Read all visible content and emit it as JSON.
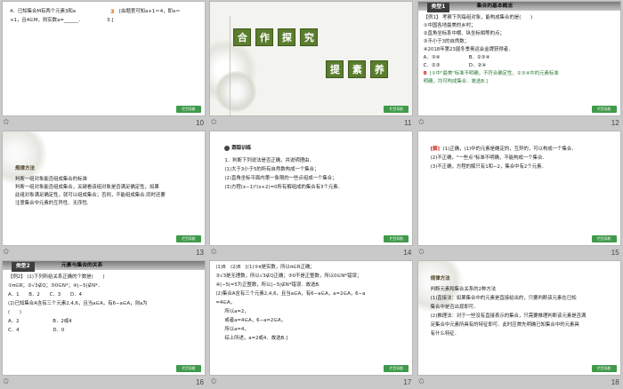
{
  "colors": {
    "accent_green": "#3f9a4a",
    "red": "#c8281e",
    "orange": "#e06a10",
    "dark_bar": "#3d3d3d"
  },
  "common": {
    "button_label": "栏目导航",
    "star_glyph": "✩"
  },
  "slides": [
    {
      "number": "10",
      "lines": [
        "4．已知集合M有两个元素3和a",
        "+1，且4∈M，则实数a=______．"
      ],
      "answer_num": "3",
      "answer_text": "[由题意可知a+1＝4，即a＝",
      "answer_text2": "3.]"
    },
    {
      "number": "11",
      "row1": [
        "合",
        "作",
        "探",
        "究"
      ],
      "row2": [
        "提",
        "素",
        "养"
      ]
    },
    {
      "number": "12",
      "category": "类型1",
      "category_title": "集合的基本概念",
      "lines": [
        "【例1】 考察下列每组对象，能构成集合的是(　　)",
        "①中国各地最美的乡村；",
        "②直角坐标系中横、纵坐标相等的点；",
        "③不小于3的自然数；",
        "④2018年第23届冬季奥运会金牌获得者．",
        "A．③④　　　　　　B．②③④",
        "C．②③　　　　　　D．②④"
      ],
      "sol_label": "B",
      "sol1": "[①中\"最美\"标准不明确，不符合确定性，②③④中的元素标准",
      "sol2": "明确，均可构成集合．故选B.]"
    },
    {
      "number": "13",
      "label": "规律方法",
      "lines": [
        "判断一组对象能否组成集合的标准",
        "判断一组对象能否组成集合，关键看该组对象是否满足确定性，如果",
        "此组对象满足确定性，就可以组成集合；否则，不能组成集合.同时还要",
        "注意集合中元素的互异性、无序性."
      ]
    },
    {
      "number": "14",
      "label": "跟踪训练",
      "lines": [
        "1．判断下列说法是否正确，并说明理由．",
        "(1)大于3小于5的所有自然数构成一个集合；",
        "(2)直角坐标平面内第一象限的一些点组成一个集合；",
        "(3)方程(x−1)²(x+2)=0所有解组成的集合有3个元素．"
      ]
    },
    {
      "number": "15",
      "jie": "[解]",
      "lines": [
        "(1)正确，(1)中的元素是确定的，互异的，可以构成一个集合．",
        "(2)不正确，\"一些点\"标准不明确，不能构成一个集合．",
        "(3)不正确，方程的解只有1和−2，集合中有2个元素．"
      ]
    },
    {
      "number": "16",
      "category": "类型2",
      "category_title": "元素与集合的关系",
      "lines": [
        "【例2】 (1)下列所给关系正确的个数是(　　)",
        "①π∈R；②√3∉Q；③0∈N*；④|−5|∉N*．",
        "A．1　　B．2　　C．3　　D．4",
        "(2)已知集合A含有三个元素2,4,6，且当a∈A，有6−a∈A，则a为",
        "(　　)",
        "A．2　　　　　　　B．2或4",
        "C．4　　　　　　　D．0"
      ]
    },
    {
      "number": "17",
      "lines": [
        "(1)B　(2)B　[(1)①π是实数，所以π∈R正确；",
        "②√3是无理数，所以√3∉Q正确；③0不是正整数，所以0∈N*错误；",
        "④|−5|=5为正整数，所以|−5|∉N*错误．故选B.",
        "(2)集合A含有三个元素2,4,6，且当a∈A，有6−a∈A，a=2∈A，6−a",
        "=4∈A，",
        "所以a=2，",
        "或者a=4∈A，6−a=2∈A，",
        "所以a=4，",
        "综上所述，a=2或4．故选B.]"
      ]
    },
    {
      "number": "18",
      "label": "规律方法",
      "lines": [
        "判断元素和集合关系的2种方法",
        "(1)直接法：如果集合中的元素是直接给出的，只要判断该元素在已知",
        "集合中是否出现即可．",
        "(2)推理法：对于一些没有直接表示的集合，只需要推理判断该元素是否满",
        "足集合中元素所具有的特征即可．此时应首先明确已知集合中的元素具",
        "有什么特征．"
      ]
    }
  ]
}
